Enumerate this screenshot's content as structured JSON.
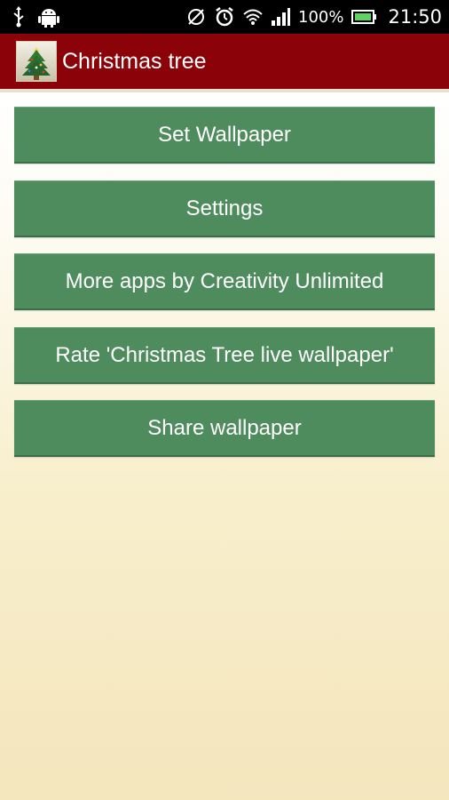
{
  "status_bar": {
    "left_icons": [
      "usb-icon",
      "android-icon"
    ],
    "right_icons": [
      "no-alert-icon",
      "alarm-icon",
      "wifi-icon",
      "signal-icon",
      "battery-icon"
    ],
    "battery_text": "100%",
    "time": "21:50"
  },
  "action_bar": {
    "title": "Christmas tree",
    "background": "#8b0208"
  },
  "menu": {
    "button_color": "#4e8c5e",
    "items": [
      {
        "label": "Set Wallpaper"
      },
      {
        "label": "Settings"
      },
      {
        "label": "More apps by Creativity Unlimited"
      },
      {
        "label": "Rate 'Christmas Tree live wallpaper'"
      },
      {
        "label": "Share wallpaper"
      }
    ]
  }
}
